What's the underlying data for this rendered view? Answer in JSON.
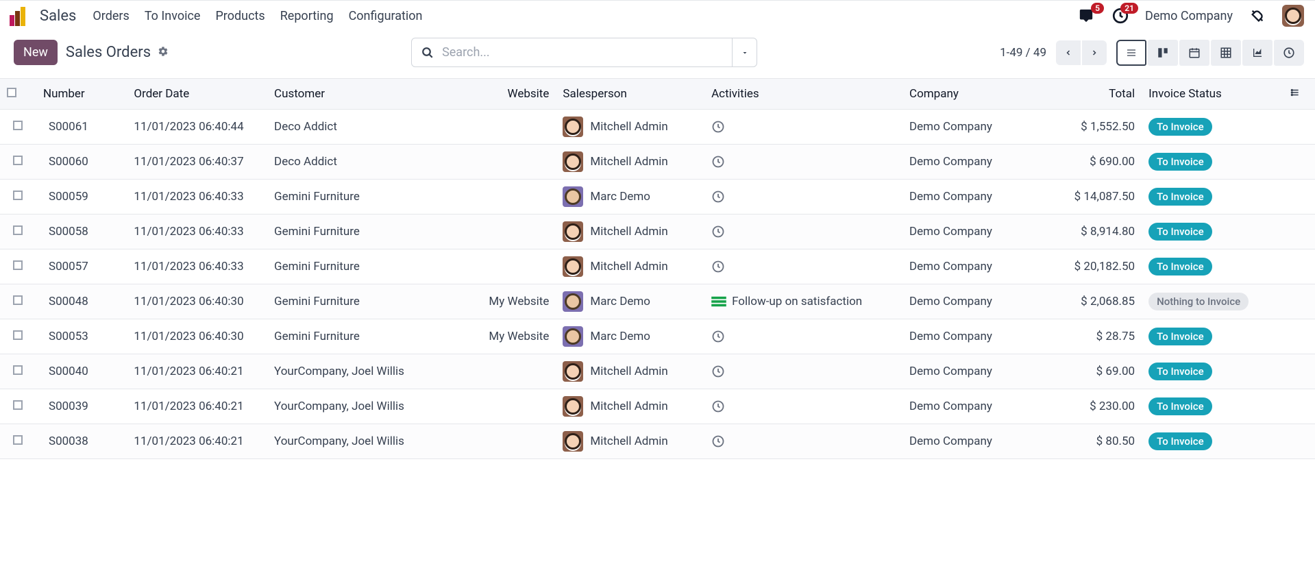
{
  "topbar": {
    "app_name": "Sales",
    "nav": [
      "Orders",
      "To Invoice",
      "Products",
      "Reporting",
      "Configuration"
    ],
    "messages_badge": "5",
    "activities_badge": "21",
    "company": "Demo Company"
  },
  "actionbar": {
    "new_label": "New",
    "title": "Sales Orders",
    "search_placeholder": "Search...",
    "pager": "1-49 / 49"
  },
  "table": {
    "columns": {
      "number": "Number",
      "order_date": "Order Date",
      "customer": "Customer",
      "website": "Website",
      "salesperson": "Salesperson",
      "activities": "Activities",
      "company": "Company",
      "total": "Total",
      "invoice_status": "Invoice Status"
    },
    "rows": [
      {
        "number": "S00061",
        "date": "11/01/2023 06:40:44",
        "customer": "Deco Addict",
        "website": "",
        "salesperson": {
          "name": "Mitchell Admin",
          "avatar": "mitchell"
        },
        "activity": {
          "type": "clock",
          "label": ""
        },
        "company": "Demo Company",
        "total": "$ 1,552.50",
        "status": "To Invoice",
        "status_class": "to-invoice"
      },
      {
        "number": "S00060",
        "date": "11/01/2023 06:40:37",
        "customer": "Deco Addict",
        "website": "",
        "salesperson": {
          "name": "Mitchell Admin",
          "avatar": "mitchell"
        },
        "activity": {
          "type": "clock",
          "label": ""
        },
        "company": "Demo Company",
        "total": "$ 690.00",
        "status": "To Invoice",
        "status_class": "to-invoice"
      },
      {
        "number": "S00059",
        "date": "11/01/2023 06:40:33",
        "customer": "Gemini Furniture",
        "website": "",
        "salesperson": {
          "name": "Marc Demo",
          "avatar": "marc"
        },
        "activity": {
          "type": "clock",
          "label": ""
        },
        "company": "Demo Company",
        "total": "$ 14,087.50",
        "status": "To Invoice",
        "status_class": "to-invoice"
      },
      {
        "number": "S00058",
        "date": "11/01/2023 06:40:33",
        "customer": "Gemini Furniture",
        "website": "",
        "salesperson": {
          "name": "Mitchell Admin",
          "avatar": "mitchell"
        },
        "activity": {
          "type": "clock",
          "label": ""
        },
        "company": "Demo Company",
        "total": "$ 8,914.80",
        "status": "To Invoice",
        "status_class": "to-invoice"
      },
      {
        "number": "S00057",
        "date": "11/01/2023 06:40:33",
        "customer": "Gemini Furniture",
        "website": "",
        "salesperson": {
          "name": "Mitchell Admin",
          "avatar": "mitchell"
        },
        "activity": {
          "type": "clock",
          "label": ""
        },
        "company": "Demo Company",
        "total": "$ 20,182.50",
        "status": "To Invoice",
        "status_class": "to-invoice"
      },
      {
        "number": "S00048",
        "date": "11/01/2023 06:40:30",
        "customer": "Gemini Furniture",
        "website": "My Website",
        "salesperson": {
          "name": "Marc Demo",
          "avatar": "marc"
        },
        "activity": {
          "type": "task",
          "label": "Follow-up on satisfaction"
        },
        "company": "Demo Company",
        "total": "$ 2,068.85",
        "status": "Nothing to Invoice",
        "status_class": "nothing"
      },
      {
        "number": "S00053",
        "date": "11/01/2023 06:40:30",
        "customer": "Gemini Furniture",
        "website": "My Website",
        "salesperson": {
          "name": "Marc Demo",
          "avatar": "marc"
        },
        "activity": {
          "type": "clock",
          "label": ""
        },
        "company": "Demo Company",
        "total": "$ 28.75",
        "status": "To Invoice",
        "status_class": "to-invoice"
      },
      {
        "number": "S00040",
        "date": "11/01/2023 06:40:21",
        "customer": "YourCompany, Joel Willis",
        "website": "",
        "salesperson": {
          "name": "Mitchell Admin",
          "avatar": "mitchell"
        },
        "activity": {
          "type": "clock",
          "label": ""
        },
        "company": "Demo Company",
        "total": "$ 69.00",
        "status": "To Invoice",
        "status_class": "to-invoice"
      },
      {
        "number": "S00039",
        "date": "11/01/2023 06:40:21",
        "customer": "YourCompany, Joel Willis",
        "website": "",
        "salesperson": {
          "name": "Mitchell Admin",
          "avatar": "mitchell"
        },
        "activity": {
          "type": "clock",
          "label": ""
        },
        "company": "Demo Company",
        "total": "$ 230.00",
        "status": "To Invoice",
        "status_class": "to-invoice"
      },
      {
        "number": "S00038",
        "date": "11/01/2023 06:40:21",
        "customer": "YourCompany, Joel Willis",
        "website": "",
        "salesperson": {
          "name": "Mitchell Admin",
          "avatar": "mitchell"
        },
        "activity": {
          "type": "clock",
          "label": ""
        },
        "company": "Demo Company",
        "total": "$ 80.50",
        "status": "To Invoice",
        "status_class": "to-invoice"
      }
    ]
  }
}
